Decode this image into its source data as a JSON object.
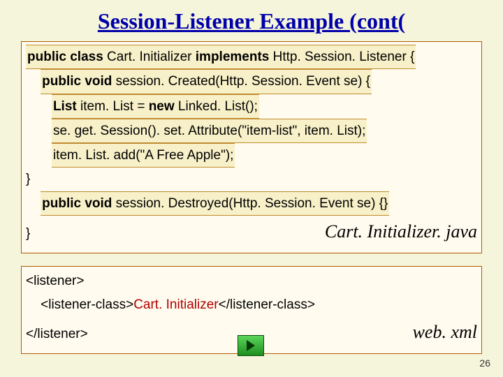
{
  "title": "Session-Listener Example (cont(",
  "java": {
    "line1_pre": "public class",
    "line1_mid": " Cart. Initializer ",
    "line1_impl": "implements",
    "line1_post": " Http. Session. Listener {",
    "line2_pre": "public void",
    "line2_post": " session. Created(Http. Session. Event se) {",
    "line3_pre": "List ",
    "line3_mid": "item. List = ",
    "line3_new": "new",
    "line3_post": " Linked. List();",
    "line4": "se. get. Session(). set. Attribute(\"item-list\", item. List);",
    "line5": "item. List. add(\"A Free Apple\");",
    "line6": "}",
    "line7_pre": "public void",
    "line7_post": " session. Destroyed(Http. Session. Event se) {}",
    "line8": "}",
    "filename": "Cart. Initializer. java"
  },
  "xml": {
    "open": "<listener>",
    "class_open": "<listener-class>",
    "class_name": "Cart. Initializer",
    "class_close": "</listener-class>",
    "close": "</listener>",
    "filename": "web. xml"
  },
  "page": "26"
}
